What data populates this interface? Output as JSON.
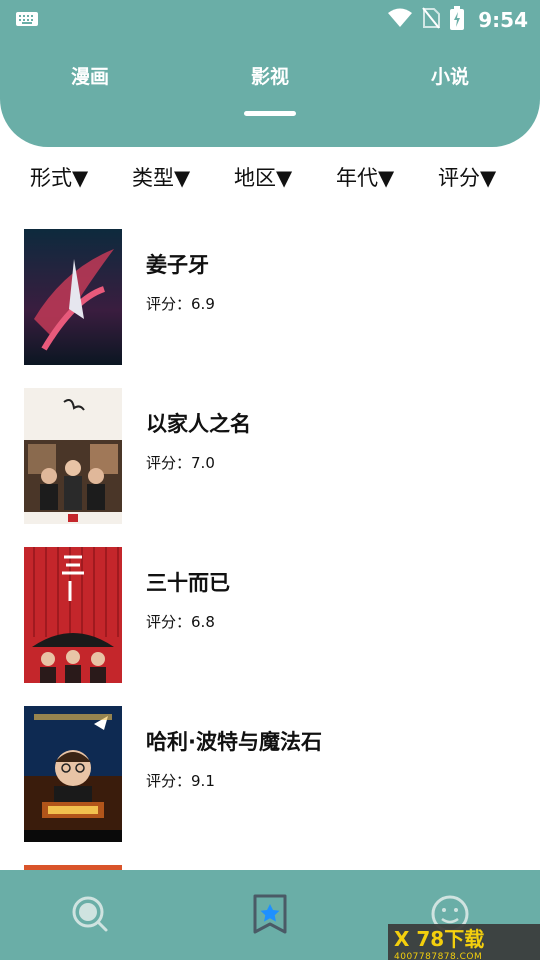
{
  "status_bar": {
    "time": "9:54",
    "icons": [
      "keyboard-icon",
      "wifi-icon",
      "no-sim-icon",
      "battery-charging-icon"
    ]
  },
  "tabs": [
    {
      "label": "漫画",
      "selected": false
    },
    {
      "label": "影视",
      "selected": true
    },
    {
      "label": "小说",
      "selected": false
    }
  ],
  "filters": [
    {
      "label": "形式▼"
    },
    {
      "label": "类型▼"
    },
    {
      "label": "地区▼"
    },
    {
      "label": "年代▼"
    },
    {
      "label": "评分▼"
    }
  ],
  "rating_prefix": "评分：",
  "items": [
    {
      "title": "姜子牙",
      "rating": "6.9",
      "poster_colors": [
        "#0d2a3d",
        "#8a1f3c",
        "#c23a57"
      ]
    },
    {
      "title": "以家人之名",
      "rating": "7.0",
      "poster_colors": [
        "#f4f0ea",
        "#6a4c3a",
        "#1c1c1c"
      ]
    },
    {
      "title": "三十而已",
      "rating": "6.8",
      "poster_colors": [
        "#c4262b",
        "#7a0f14",
        "#1a1a1a"
      ]
    },
    {
      "title": "哈利·波特与魔法石",
      "rating": "9.1",
      "poster_colors": [
        "#0e2a52",
        "#b2551a",
        "#f2c14e"
      ]
    }
  ],
  "bottom_nav": [
    {
      "icon": "search-icon",
      "active": false
    },
    {
      "icon": "bookmark-star-icon",
      "active": true
    },
    {
      "icon": "smiley-icon",
      "active": false
    }
  ],
  "watermark": {
    "brand": "X 78下载",
    "url": "4007787878.COM"
  },
  "colors": {
    "accent": "#6aaea7",
    "text": "#111111",
    "active_icon": "#1e90ff"
  }
}
